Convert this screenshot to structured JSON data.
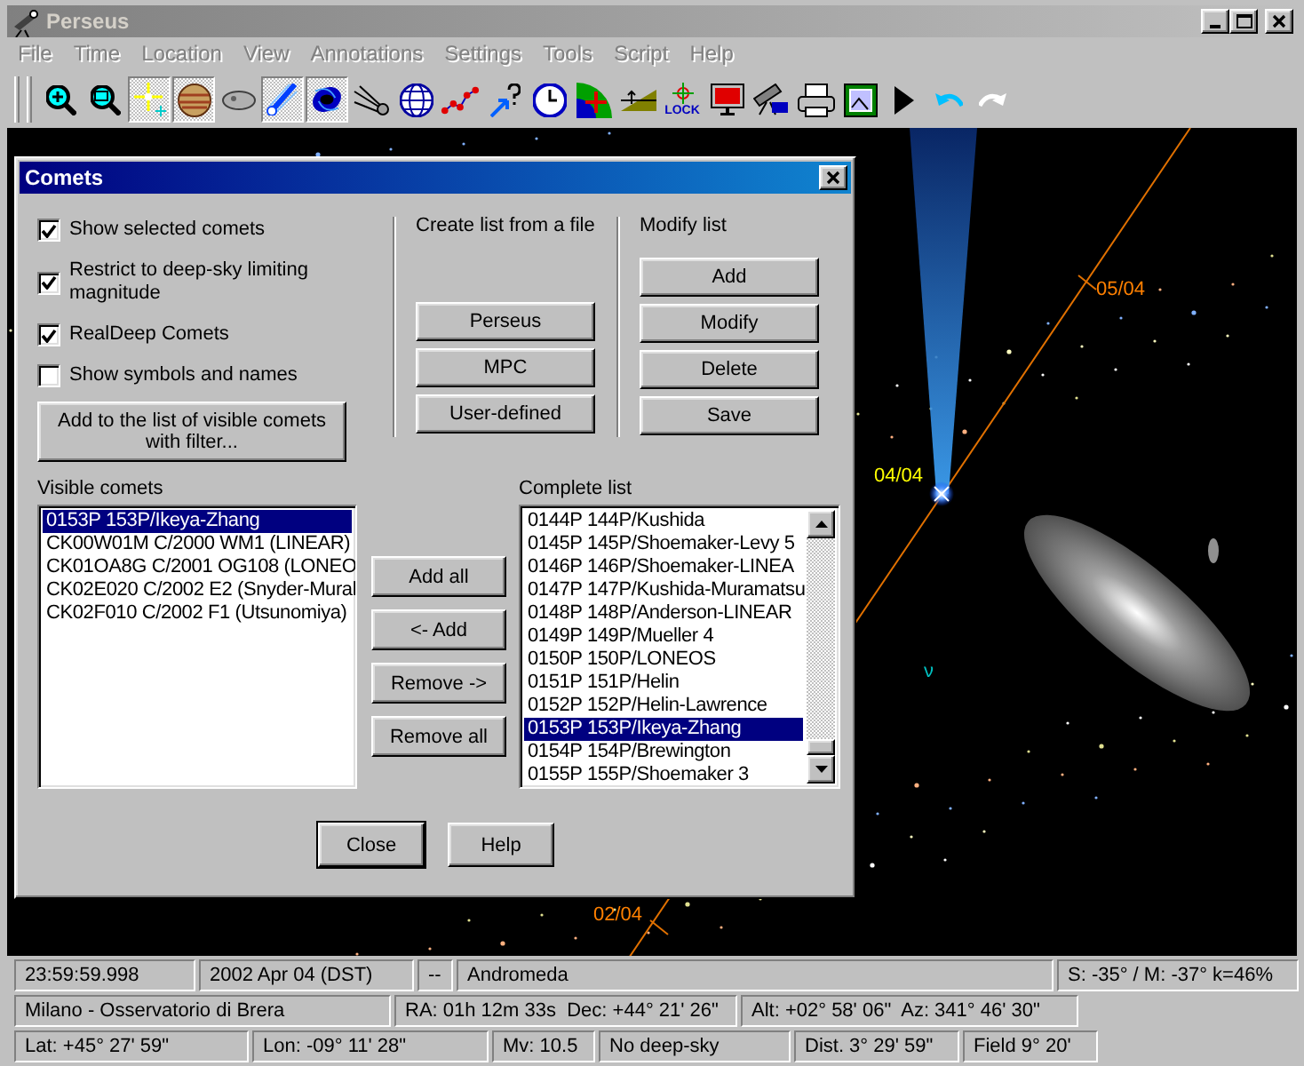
{
  "window": {
    "title": "Perseus",
    "active": false
  },
  "menu": {
    "disabled": true,
    "items": [
      "File",
      "Time",
      "Location",
      "View",
      "Annotations",
      "Settings",
      "Tools",
      "Script",
      "Help"
    ]
  },
  "toolbar": [
    {
      "pressed": false
    },
    {
      "pressed": false
    },
    {
      "pressed": true
    },
    {
      "pressed": true
    },
    {
      "pressed": false
    },
    {
      "pressed": true
    },
    {
      "pressed": true
    },
    {
      "pressed": false
    },
    {
      "pressed": false
    },
    {
      "pressed": false
    },
    {
      "pressed": false
    },
    {
      "pressed": false
    },
    {
      "pressed": false
    },
    {
      "pressed": false
    },
    {
      "pressed": false,
      "label": "LOCK"
    },
    {
      "pressed": false
    },
    {
      "pressed": false
    },
    {
      "pressed": false
    },
    {
      "pressed": false
    },
    {
      "pressed": false
    },
    {
      "pressed": false
    },
    {
      "pressed": false
    }
  ],
  "sky": {
    "labels": [
      {
        "text": "05/04",
        "color": "#ff8000"
      },
      {
        "text": "04/04",
        "color": "#ffff00"
      },
      {
        "text": "02/04",
        "color": "#ff8000"
      },
      {
        "text": "ν",
        "color": "#00c0c0"
      }
    ]
  },
  "dialog": {
    "title": "Comets",
    "options": [
      {
        "label": "Show selected comets",
        "checked": true
      },
      {
        "label": "Restrict to deep-sky limiting magnitude",
        "checked": true
      },
      {
        "label": "RealDeep Comets",
        "checked": true
      },
      {
        "label": "Show symbols and names",
        "checked": false
      }
    ],
    "filter_button": "Add to the list of visible comets with filter...",
    "create_list": {
      "label": "Create list from a file",
      "buttons": [
        "Perseus",
        "MPC",
        "User-defined"
      ]
    },
    "modify_list": {
      "label": "Modify list",
      "buttons": [
        "Add",
        "Modify",
        "Delete",
        "Save"
      ]
    },
    "visible": {
      "label": "Visible comets",
      "items": [
        {
          "text": "0153P 153P/Ikeya-Zhang",
          "selected": true
        },
        {
          "text": "CK00W01M C/2000 WM1 (LINEAR)",
          "selected": false
        },
        {
          "text": "CK01OA8G C/2001 OG108 (LONEO",
          "selected": false
        },
        {
          "text": "CK02E020 C/2002 E2 (Snyder-Mural",
          "selected": false
        },
        {
          "text": "CK02F010 C/2002 F1 (Utsunomiya)",
          "selected": false
        }
      ]
    },
    "transfer_buttons": [
      "Add all",
      "<- Add",
      "Remove ->",
      "Remove all"
    ],
    "complete": {
      "label": "Complete list",
      "items": [
        {
          "text": "0144P 144P/Kushida",
          "selected": false
        },
        {
          "text": "0145P 145P/Shoemaker-Levy 5",
          "selected": false
        },
        {
          "text": "0146P 146P/Shoemaker-LINEA",
          "selected": false
        },
        {
          "text": "0147P 147P/Kushida-Muramatsu",
          "selected": false
        },
        {
          "text": "0148P 148P/Anderson-LINEAR",
          "selected": false
        },
        {
          "text": "0149P 149P/Mueller 4",
          "selected": false
        },
        {
          "text": "0150P 150P/LONEOS",
          "selected": false
        },
        {
          "text": "0151P 151P/Helin",
          "selected": false
        },
        {
          "text": "0152P 152P/Helin-Lawrence",
          "selected": false
        },
        {
          "text": "0153P 153P/Ikeya-Zhang",
          "selected": true
        },
        {
          "text": "0154P 154P/Brewington",
          "selected": false
        },
        {
          "text": "0155P 155P/Shoemaker 3",
          "selected": false
        }
      ]
    },
    "footer_buttons": [
      {
        "label": "Close",
        "default": true
      },
      {
        "label": "Help",
        "default": false
      }
    ]
  },
  "status_bar": {
    "lines": [
      {
        "fields": [
          "23:59:59.998",
          "2002 Apr 04 (DST)",
          "--",
          "Andromeda",
          "S: -35° / M: -37° k=46%"
        ]
      },
      {
        "fields": [
          "Milano - Osservatorio di Brera",
          "RA: 01h 12m 33s  Dec: +44° 21' 26\"",
          "Alt: +02° 58' 06\"  Az: 341° 46' 30\""
        ]
      },
      {
        "fields": [
          "Lat: +45° 27' 59\"",
          "Lon: -09° 11' 28\"",
          "Mv: 10.5",
          "No deep-sky",
          "Dist. 3° 29' 59\"",
          "Field 9° 20'"
        ]
      }
    ]
  }
}
